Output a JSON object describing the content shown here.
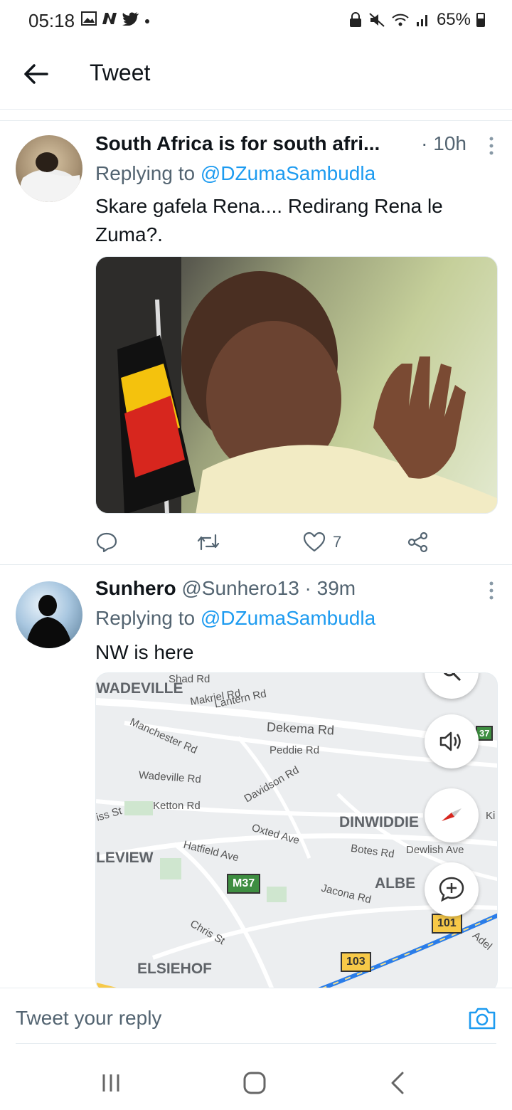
{
  "status_bar": {
    "time": "05:18",
    "battery": "65%",
    "left_icons": [
      "gallery-icon",
      "n-icon",
      "twitter-bird-icon",
      "dot-icon"
    ],
    "right_icons": [
      "lock-icon",
      "mute-icon",
      "wifi-icon",
      "signal-icon",
      "battery-icon"
    ]
  },
  "header": {
    "title": "Tweet"
  },
  "tweets": [
    {
      "name": "South Africa is for south afri...",
      "handle": "",
      "time": "· 10h",
      "replying_label": "Replying to ",
      "replying_handle": "@DZumaSambudla",
      "text": "Skare gafela Rena.... Redirang Rena le Zuma?.",
      "media": "photo",
      "likes": "7"
    },
    {
      "name": "Sunhero",
      "handle": "@Sunhero13 · 39m",
      "replying_label": "Replying to ",
      "replying_handle": "@DZumaSambudla",
      "text": "NW is here",
      "media": "map"
    }
  ],
  "map": {
    "labels": [
      "WADEVILLE",
      "Shad Rd",
      "Makriel Rd",
      "Lantern Rd",
      "Manchester Rd",
      "Dekema Rd",
      "Peddie Rd",
      "Wadeville Rd",
      "Davidson Rd",
      "Ketton Rd",
      "iss St",
      "Oxted Ave",
      "DINWIDDIE",
      "Ki",
      "LEVIEW",
      "Hatfield Ave",
      "Botes Rd",
      "Dewlish Ave",
      "ALBE",
      "Jacona Rd",
      "Chris St",
      "Adel",
      "ELSIEHOF"
    ],
    "badges": [
      "M37",
      "37",
      "101",
      "103"
    ]
  },
  "reply_bar": {
    "placeholder": "Tweet your reply"
  },
  "colors": {
    "accent": "#1d9bf0",
    "secondary_text": "#536471",
    "divider": "#e6ecf0"
  }
}
